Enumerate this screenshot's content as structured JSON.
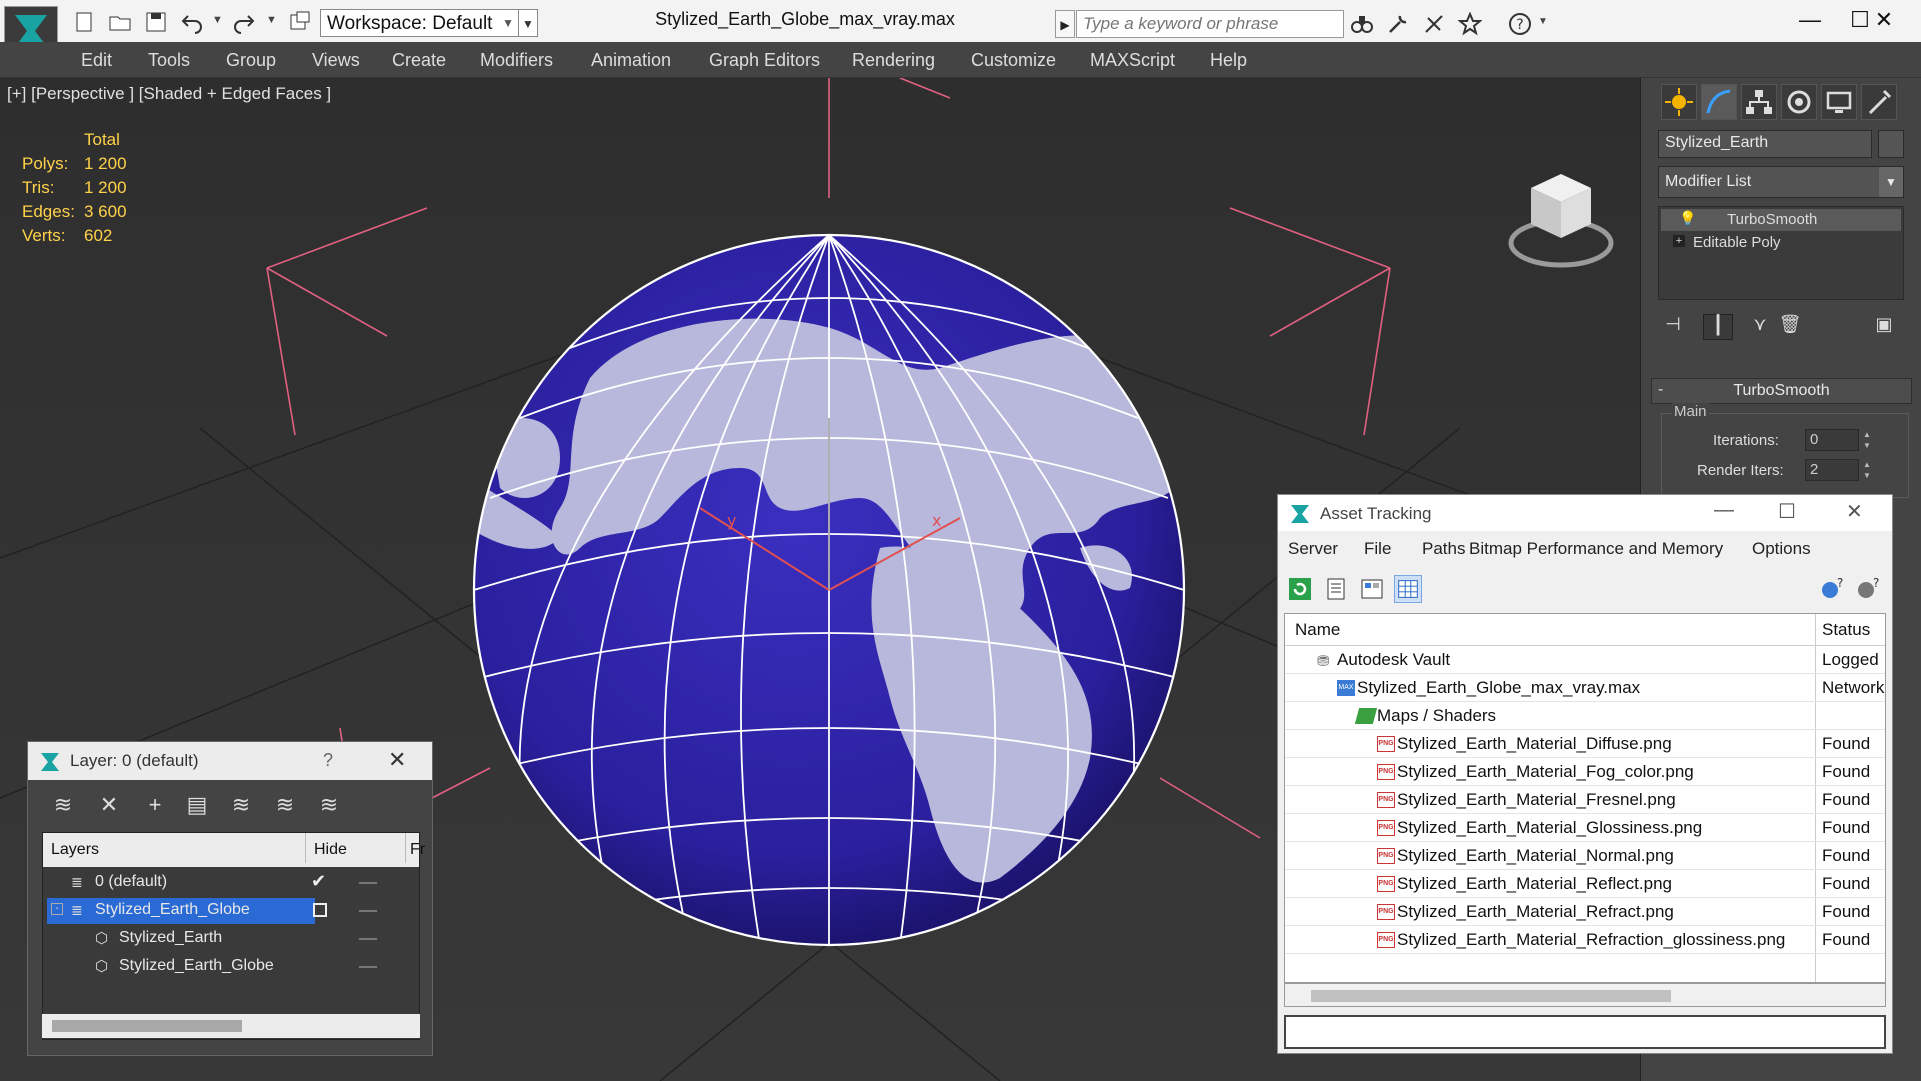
{
  "titlebar": {
    "workspace": "Workspace: Default",
    "document_title": "Stylized_Earth_Globe_max_vray.max",
    "search_placeholder": "Type a keyword or phrase",
    "minimize": "—",
    "maximize": "☐",
    "close": "✕"
  },
  "menu": [
    "Edit",
    "Tools",
    "Group",
    "Views",
    "Create",
    "Modifiers",
    "Animation",
    "Graph Editors",
    "Rendering",
    "Customize",
    "MAXScript",
    "Help"
  ],
  "viewport": {
    "label": "[+] [Perspective ] [Shaded + Edged Faces ]",
    "stats": {
      "header": "Total",
      "polys_label": "Polys:",
      "polys": "1 200",
      "tris_label": "Tris:",
      "tris": "1 200",
      "edges_label": "Edges:",
      "edges": "3 600",
      "verts_label": "Verts:",
      "verts": "602"
    },
    "axis_x": "x",
    "axis_y": "y",
    "colors": {
      "globe": "#2e22a8",
      "land": "#b8b8dc",
      "bbox": "#e06080"
    }
  },
  "command_panel": {
    "object_name": "Stylized_Earth",
    "modifier_list": "Modifier List",
    "stack": [
      "TurboSmooth",
      "Editable Poly"
    ],
    "rollout_title": "TurboSmooth",
    "main_label": "Main",
    "iterations_label": "Iterations:",
    "iterations": "0",
    "render_iters_label": "Render Iters:",
    "render_iters": "2"
  },
  "layer_dialog": {
    "title": "Layer: 0 (default)",
    "help": "?",
    "close": "✕",
    "col_layers": "Layers",
    "col_hide": "Hide",
    "col_freeze": "Fr",
    "rows": [
      {
        "name": "0 (default)"
      },
      {
        "name": "Stylized_Earth_Globe"
      },
      {
        "name": "Stylized_Earth"
      },
      {
        "name": "Stylized_Earth_Globe"
      }
    ]
  },
  "asset_tracking": {
    "title": "Asset Tracking",
    "menu": [
      "Server",
      "File",
      "Paths",
      "Bitmap Performance and Memory",
      "Options"
    ],
    "col_name": "Name",
    "col_status": "Status",
    "rows": [
      {
        "name": "Autodesk Vault",
        "status": "Logged"
      },
      {
        "name": "Stylized_Earth_Globe_max_vray.max",
        "status": "Network"
      },
      {
        "name": "Maps / Shaders",
        "status": ""
      },
      {
        "name": "Stylized_Earth_Material_Diffuse.png",
        "status": "Found"
      },
      {
        "name": "Stylized_Earth_Material_Fog_color.png",
        "status": "Found"
      },
      {
        "name": "Stylized_Earth_Material_Fresnel.png",
        "status": "Found"
      },
      {
        "name": "Stylized_Earth_Material_Glossiness.png",
        "status": "Found"
      },
      {
        "name": "Stylized_Earth_Material_Normal.png",
        "status": "Found"
      },
      {
        "name": "Stylized_Earth_Material_Reflect.png",
        "status": "Found"
      },
      {
        "name": "Stylized_Earth_Material_Refract.png",
        "status": "Found"
      },
      {
        "name": "Stylized_Earth_Material_Refraction_glossiness.png",
        "status": "Found"
      }
    ]
  }
}
